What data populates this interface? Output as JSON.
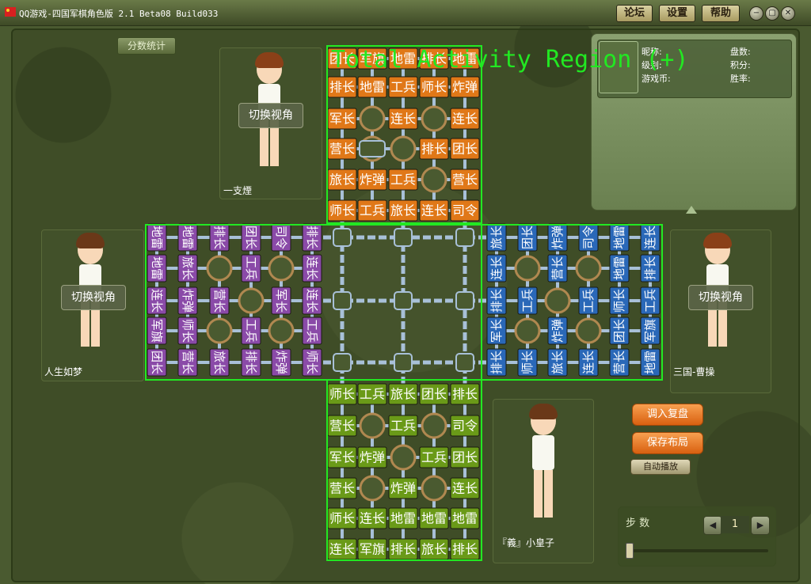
{
  "window": {
    "title": "QQ游戏-四国军棋角色版 2.1 Beta08 Build033"
  },
  "titlebar": {
    "forum_label": "论坛",
    "settings_label": "设置",
    "help_label": "帮助",
    "min_glyph": "−",
    "restore_glyph": "▢",
    "close_glyph": "✕"
  },
  "score_tab": "分数统计",
  "players": {
    "top": {
      "name": "一支煙",
      "switch_label": "切换视角"
    },
    "left": {
      "name": "人生如梦",
      "switch_label": "切换视角"
    },
    "right": {
      "name": "三国-曹操",
      "switch_label": "切换视角"
    },
    "bottom": {
      "name": "『義』小皇子"
    }
  },
  "info": {
    "nickname_label": "昵称:",
    "level_label": "级别:",
    "coins_label": "游戏币:",
    "games_label": "盘数:",
    "points_label": "积分:",
    "winrate_label": "胜率:"
  },
  "buttons": {
    "load_replay": "调入复盘",
    "save_layout": "保存布局",
    "autoplay": "自动播放"
  },
  "steps": {
    "label": "步 数",
    "value": "1",
    "prev_glyph": "◀",
    "next_glyph": "▶"
  },
  "overlay": {
    "label": "Total Activity Region (+)"
  },
  "colors": {
    "orange": "#e07818",
    "purple": "#8a4aa8",
    "blue": "#2a68b8",
    "green": "#6a9a18",
    "highlight": "#22e822"
  },
  "pieces": {
    "top": [
      [
        "团长",
        "军旗",
        "地雷",
        "排长",
        "地雷"
      ],
      [
        "排长",
        "地雷",
        "工兵",
        "师长",
        "炸弹"
      ],
      [
        "军长",
        "",
        "连长",
        "",
        "连长"
      ],
      [
        "营长",
        "",
        "",
        "排长",
        "团长"
      ],
      [
        "旅长",
        "炸弹",
        "工兵",
        "",
        "营长"
      ],
      [
        "师长",
        "工兵",
        "旅长",
        "连长",
        "司令"
      ]
    ],
    "bottom": [
      [
        "师长",
        "工兵",
        "旅长",
        "团长",
        "排长"
      ],
      [
        "营长",
        "",
        "工兵",
        "",
        "司令"
      ],
      [
        "军长",
        "炸弹",
        "",
        "工兵",
        "团长"
      ],
      [
        "营长",
        "",
        "炸弹",
        "",
        "连长"
      ],
      [
        "师长",
        "连长",
        "地雷",
        "地雷",
        "地雷"
      ],
      [
        "连长",
        "军旗",
        "排长",
        "旅长",
        "排长"
      ]
    ],
    "left": [
      [
        "地雷",
        "地雷",
        "排长",
        "团长",
        "司令",
        "排长"
      ],
      [
        "地雷",
        "旅长",
        "",
        "工兵",
        "",
        "连长"
      ],
      [
        "连长",
        "炸弹",
        "营长",
        "",
        "军长",
        "连长"
      ],
      [
        "军旗",
        "师长",
        "",
        "工兵",
        "",
        "工兵"
      ],
      [
        "团长",
        "营长",
        "旅长",
        "排长",
        "炸弹",
        "师长"
      ]
    ],
    "right": [
      [
        "旅长",
        "团长",
        "炸弹",
        "司令",
        "地雷",
        "连长"
      ],
      [
        "连长",
        "",
        "营长",
        "",
        "地雷",
        "排长"
      ],
      [
        "排长",
        "工兵",
        "",
        "工兵",
        "师长",
        "工兵"
      ],
      [
        "军长",
        "",
        "炸弹",
        "",
        "团长",
        "军旗"
      ],
      [
        "排长",
        "师长",
        "旅长",
        "连长",
        "营长",
        "地雷"
      ]
    ]
  }
}
